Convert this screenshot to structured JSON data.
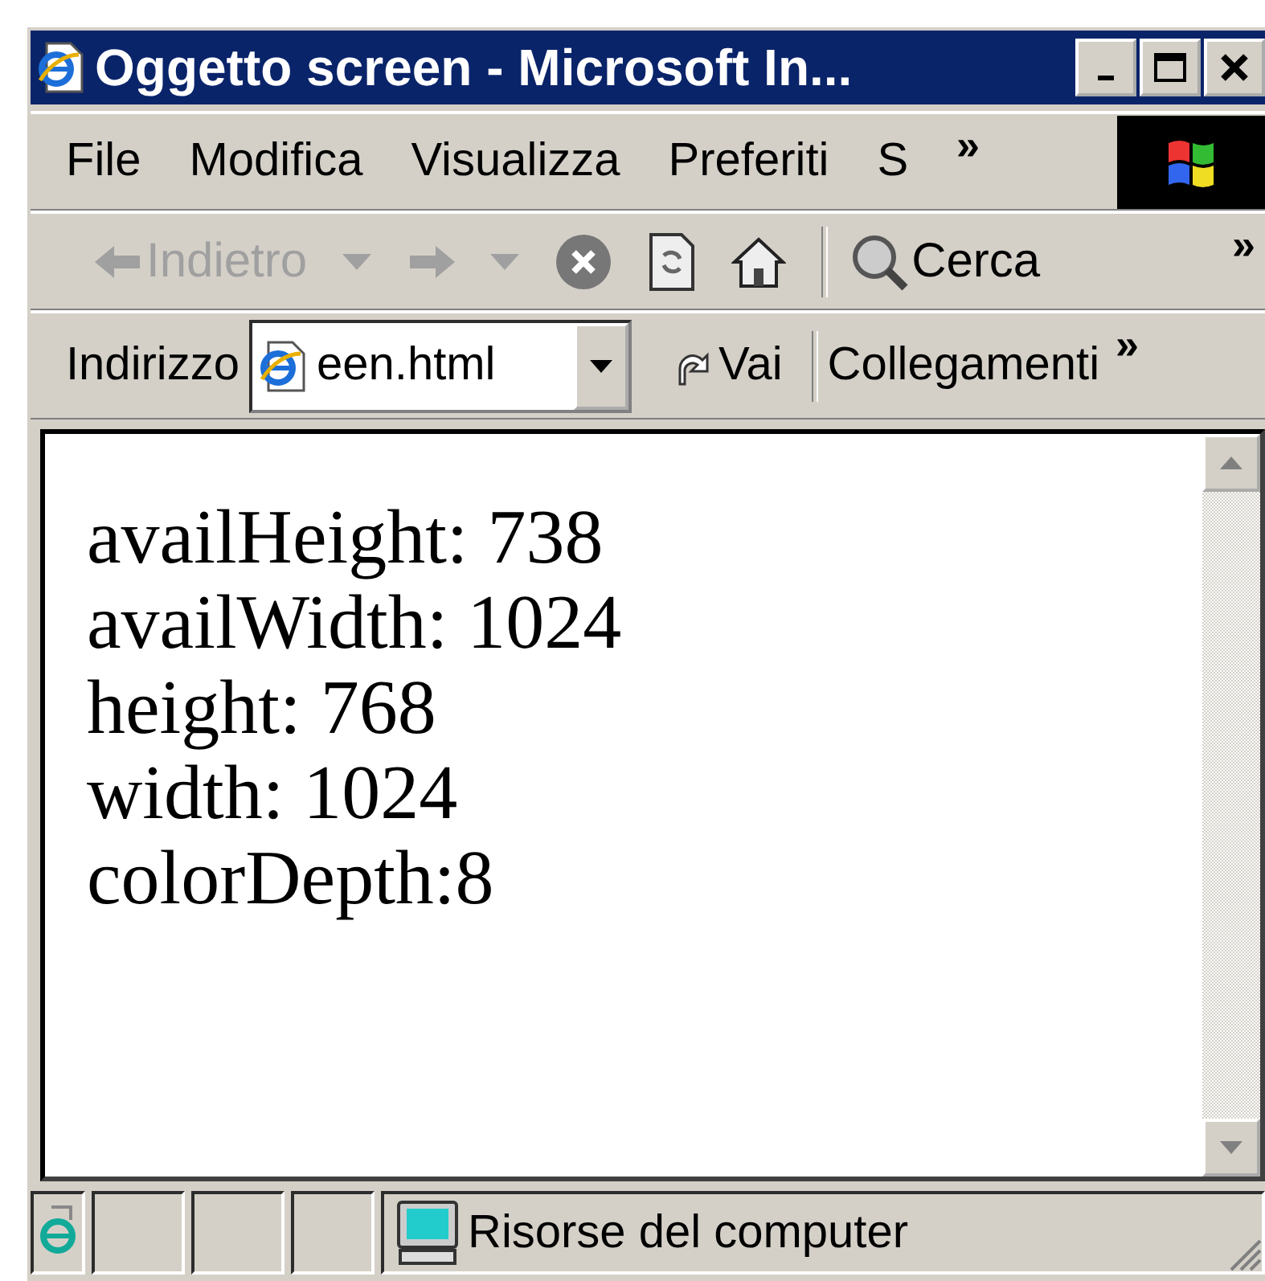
{
  "window": {
    "title": "Oggetto screen - Microsoft In..."
  },
  "menu": {
    "items": [
      "File",
      "Modifica",
      "Visualizza",
      "Preferiti",
      "S"
    ],
    "chevron": "»"
  },
  "toolbar": {
    "items": [
      {
        "kind": "back",
        "label": "Indietro",
        "disabled": true
      },
      {
        "kind": "forward",
        "disabled": true
      },
      {
        "kind": "stop"
      },
      {
        "kind": "refresh"
      },
      {
        "kind": "home"
      },
      {
        "kind": "separator"
      },
      {
        "kind": "search",
        "label": "Cerca"
      }
    ],
    "chevron": "»"
  },
  "address_bar": {
    "label": "Indirizzo",
    "value": "een.html",
    "go": "Vai",
    "links": "Collegamenti",
    "chevron": "»"
  },
  "content": {
    "lines": [
      "availHeight: 738",
      "availWidth: 1024",
      "height: 768",
      "width: 1024",
      "colorDepth:8"
    ]
  },
  "status_bar": {
    "text": "Risorse del computer"
  }
}
